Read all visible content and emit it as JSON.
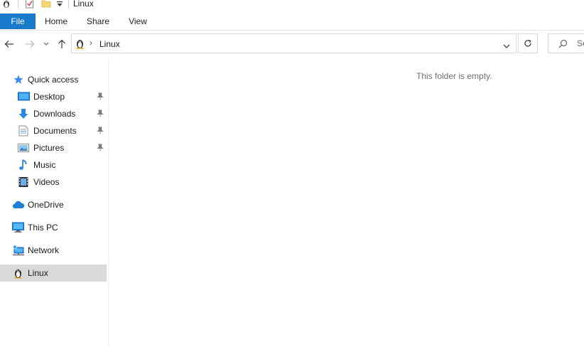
{
  "window": {
    "title": "Linux"
  },
  "ribbon": {
    "tabs": [
      "File",
      "Home",
      "Share",
      "View"
    ]
  },
  "address": {
    "location": "Linux",
    "separator": "›"
  },
  "search": {
    "placeholder": "Se"
  },
  "nav": {
    "quick_access": "Quick access",
    "quick_items": [
      {
        "label": "Desktop",
        "icon": "desktop-folder-icon",
        "pinned": true
      },
      {
        "label": "Downloads",
        "icon": "downloads-folder-icon",
        "pinned": true
      },
      {
        "label": "Documents",
        "icon": "documents-folder-icon",
        "pinned": true
      },
      {
        "label": "Pictures",
        "icon": "pictures-folder-icon",
        "pinned": true
      },
      {
        "label": "Music",
        "icon": "music-folder-icon",
        "pinned": false
      },
      {
        "label": "Videos",
        "icon": "videos-folder-icon",
        "pinned": false
      }
    ],
    "onedrive": "OneDrive",
    "this_pc": "This PC",
    "network": "Network",
    "linux": "Linux"
  },
  "content": {
    "empty_message": "This folder is empty."
  },
  "colors": {
    "file_tab": "#1979ca",
    "selected_nav": "#d9d9d9",
    "accent": "#1e88e5"
  }
}
